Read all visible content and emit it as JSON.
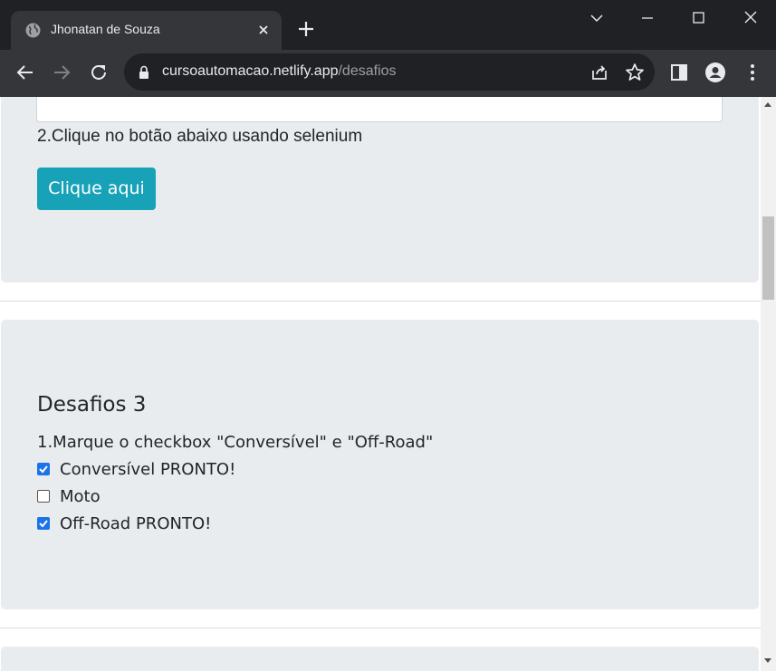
{
  "browser": {
    "tab": {
      "title": "Jhonatan de Souza",
      "favicon": "globe-icon"
    },
    "url": {
      "host": "cursoautomacao.netlify.app",
      "path": "/desafios"
    },
    "colors": {
      "frame": "#202124",
      "toolbar": "#35363a",
      "text": "#e8eaed"
    }
  },
  "page": {
    "desafio2": {
      "instruction": "2.Clique no botão abaixo usando selenium",
      "button_label": "Clique aqui"
    },
    "desafio3": {
      "heading": "Desafios 3",
      "instruction": "1.Marque o checkbox \"Conversível\" e \"Off-Road\"",
      "options": [
        {
          "label": "Conversível PRONTO!",
          "checked": true
        },
        {
          "label": "Moto",
          "checked": false
        },
        {
          "label": "Off-Road PRONTO!",
          "checked": true
        }
      ]
    },
    "colors": {
      "card": "#e9ecef",
      "button": "#17a2b8",
      "checkbox": "#1a73e8"
    }
  }
}
